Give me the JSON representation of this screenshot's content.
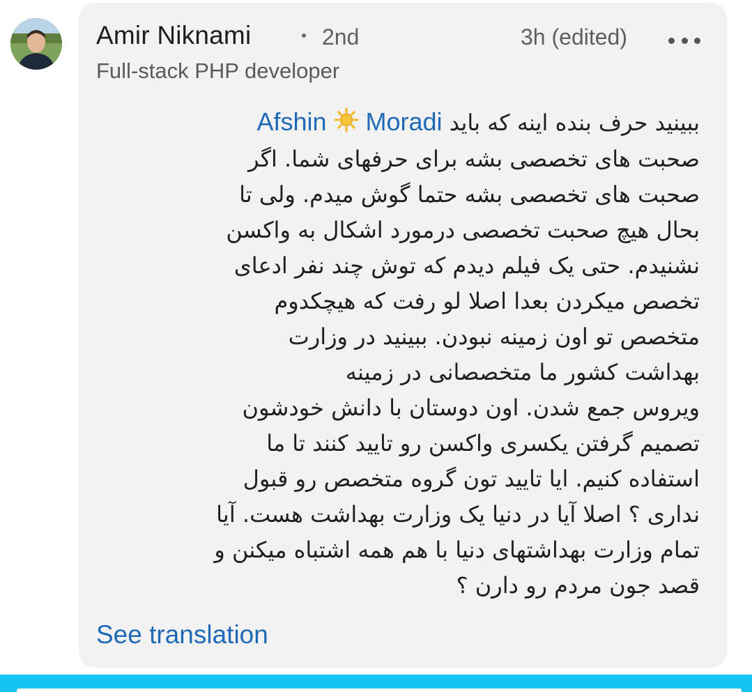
{
  "author": {
    "name": "Amir Niknami",
    "degree": "2nd",
    "headline": "Full-stack PHP developer",
    "avatar_icon": "profile-photo"
  },
  "meta": {
    "time": "3h (edited)",
    "more_icon": "ellipsis-icon"
  },
  "comment": {
    "lead_text": "ببینید حرف بنده اینه که باید",
    "mention": {
      "first": "Afshin",
      "emoji": "☀️",
      "last": "Moradi"
    },
    "lines": [
      "صحبت های تخصصی بشه برای حرفهای شما. اگر",
      "صحبت های تخصصی بشه حتما گوش میدم. ولی تا",
      "بحال هیچ صحبت تخصصی درمورد اشکال به واکسن",
      "نشنیدم. حتی یک فیلم دیدم که توش چند نفر ادعای",
      "تخصص میکردن بعدا اصلا لو رفت که هیچکدوم",
      "متخصص تو اون زمینه نبودن. ببینید در وزارت",
      "بهداشت کشور ما متخصصانی در زمینه",
      "ویروس جمع شدن. اون دوستان با دانش خودشون",
      "تصمیم گرفتن یکسری واکسن رو تایید کنند تا ما",
      "استفاده کنیم. ایا تایید تون گروه متخصص رو قبول",
      "نداری ؟ اصلا آیا در دنیا یک وزارت بهداشت هست. آیا",
      "تمام وزارت بهداشتهای دنیا با هم همه اشتباه میکنن و",
      "قصد جون مردم رو دارن ؟"
    ]
  },
  "actions": {
    "see_translation": "See translation"
  },
  "colors": {
    "card_bg": "#f2f2f2",
    "link": "#1f6ab8",
    "accent_bar": "#16c3f2",
    "sun": "#f5b51f"
  }
}
